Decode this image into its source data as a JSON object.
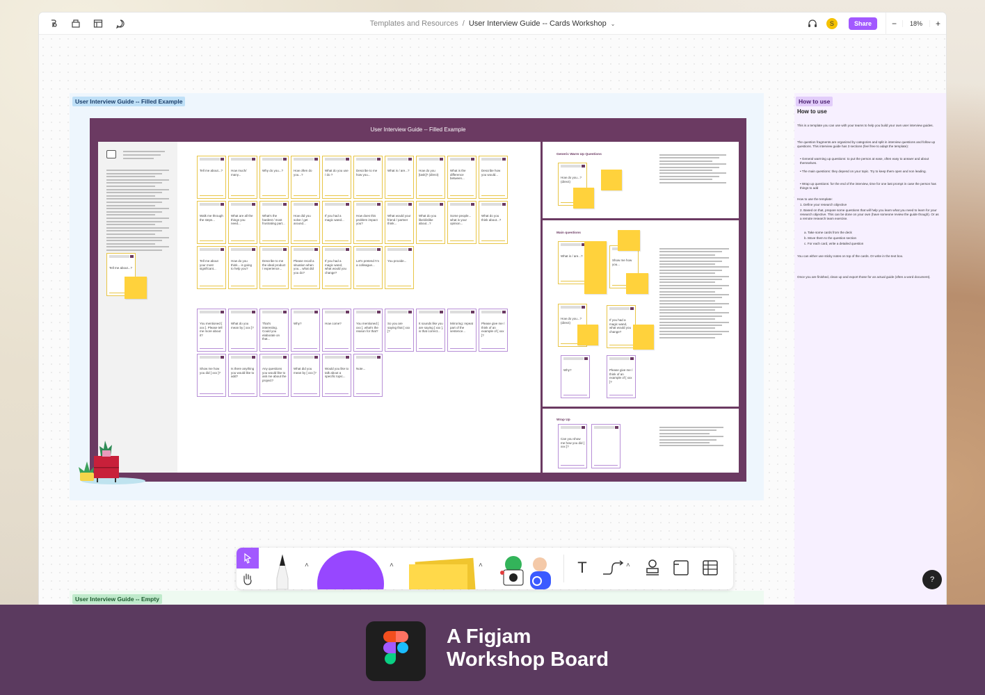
{
  "topbar": {
    "breadcrumb_parent": "Templates and Resources",
    "breadcrumb_separator": "/",
    "breadcrumb_current": "User Interview Guide -- Cards Workshop",
    "avatar_initial": "S",
    "share_label": "Share",
    "zoom_minus": "−",
    "zoom_value": "18%",
    "zoom_plus": "+",
    "icons": [
      "figjam-menu-icon",
      "library-icon",
      "layout-icon",
      "comment-icon",
      "headphones-icon"
    ]
  },
  "sections": {
    "filled_label": "User Interview Guide -- Filled Example",
    "board_title": "User Interview Guide -- Filled Example",
    "howto_label": "How to use",
    "empty_label": "User Interview Guide -- Empty"
  },
  "board": {
    "warmup_heading": "Generic Warm Up Questions",
    "main_heading": "Main questions",
    "wrap_heading": "Wrap Up",
    "yellow_cards": [
      "Tell me about...?",
      "How much/ many...",
      "Why do you...?",
      "How often do you...?",
      "What do you use / do ?",
      "Describe to me how you...",
      "What is / are...?",
      "How do you [task]? (direct)",
      "What is the difference between...",
      "Describe how you would...",
      "Walk me through the steps...",
      "What are all the things you need...",
      "What's the hardest / most frustrating part...",
      "How did you solve / get around...",
      "If you had a magic wand...",
      "How does this problem impact you?",
      "What would your friend / partner think...",
      "What do you like/dislike about...?",
      "Some people... what is your opinion...",
      "What do you think about...?",
      "Tell me about your most significant...",
      "How do you think... is going to help you?",
      "Describe to me the ideal product / experience...",
      "Please recall a situation when you... what did you do?",
      "If you had a magic wand, what would you change?",
      "Let's pretend I'm a colleague...",
      "You provide..."
    ],
    "purple_cards": [
      "You mentioned [ xxx ]. Please tell me more about it?",
      "What do you mean by [ xxx ]?",
      "That's interesting. Could you elaborate on that...",
      "Why?",
      "How come?",
      "You mentioned [ xxx ], what's the reason for that?",
      "So you are saying that [ xxx ]?",
      "It sounds like you are saying [ xxx ], is that correct...",
      "Mirroring: repeat part of the sentence...",
      "Please give me / think of an example of [ xxx ]?",
      "Show me how you did [ xxx ]?",
      "Is there anything you would like to add?",
      "Any questions you would like to ask me about the project?",
      "What did you mean by [ xxx ]?",
      "Would you like to talk about a specific topic...",
      "Note..."
    ],
    "warmup_cards": [
      "How do you...? (direct)"
    ],
    "main_cards": [
      "What is / are...?",
      "Show me how you...",
      "How do you...? (direct)",
      "If you had a magic wand, what would you change?",
      "Why?",
      "Please give me / think of an example of [ xxx ]?"
    ],
    "wrap_cards": [
      "Can you show me how you did [ xxx ]?"
    ],
    "left_note_card": "Tell me about...?"
  },
  "howto": {
    "title": "How to use",
    "p1": "This is a template you can use with your teams to help you build your own user interview guides.",
    "p2": "The question fragments are organized by categories and split in interview questions and follow up questions. This interview guide has 3 sections (feel free to adapt the template):",
    "b1": "• General warming up questions: to put the person at ease, often easy to answer and about themselves.",
    "b2": "• The main questions: they depend on your topic. Try to keep them open and non leading.",
    "b3": "• Wrap up questions: for the end of the interview, time for one last prompt in case the person has things to add",
    "p3": "How to use the template:",
    "s1": "1. Define your research objective",
    "s2": "2. Based on that, prepare some questions that will help you learn what you need to learn for your research objective. This can be done on your own (have someone review the guide though). Or as a remote research team exercise.",
    "s2a": "a. Take some cards from the deck",
    "s2b": "b. Move them to the question section",
    "s2c": "c. For each card, write a detailed question",
    "p4": "You can either use sticky notes on top of the cards. Or write in the text box.",
    "p5": "Once you are finished, clean up and export those for an actual guide (often a word document)."
  },
  "toolbar": {
    "tools": [
      "select-tool",
      "hand-tool",
      "marker-tool",
      "shape-tool",
      "sticky-tool",
      "stickers-tool",
      "text-tool",
      "connector-tool",
      "stamp-tool",
      "section-tool",
      "table-tool"
    ],
    "text_glyph": "T"
  },
  "help_label": "?",
  "footer": {
    "line1": "A Figjam",
    "line2": "Workshop Board"
  },
  "colors": {
    "accent": "#a259ff",
    "board_purple": "#6b3a62",
    "sticky_yellow": "#ffd23c",
    "footer_bg": "#5b3a5f"
  }
}
